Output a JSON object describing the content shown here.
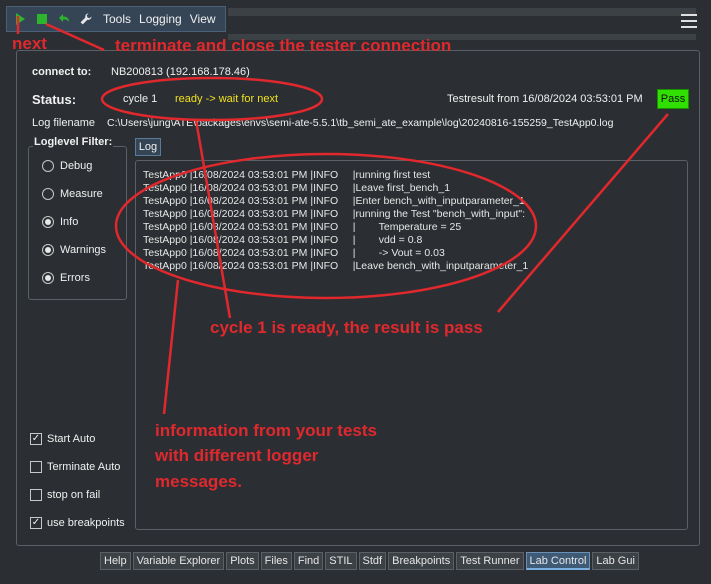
{
  "toolbar": {
    "menu_tools": "Tools",
    "menu_logging": "Logging",
    "menu_view": "View"
  },
  "connection": {
    "label": "connect to:",
    "value": "NB200813 (192.168.178.46)"
  },
  "status": {
    "label": "Status:",
    "cycle": "cycle 1",
    "state": "ready -> wait for next",
    "testresult": "Testresult from 16/08/2024 03:53:01 PM",
    "result_badge": "Pass"
  },
  "log_filename": {
    "label": "Log filename",
    "value": "C:\\Users\\jung\\ATE\\packages\\envs\\semi-ate-5.5.1\\tb_semi_ate_example\\log\\20240816-155259_TestApp0.log"
  },
  "loglevel_filter": {
    "title": "Loglevel Filter:",
    "options": [
      {
        "label": "Debug",
        "checked": false
      },
      {
        "label": "Measure",
        "checked": false
      },
      {
        "label": "Info",
        "checked": true
      },
      {
        "label": "Warnings",
        "checked": true
      },
      {
        "label": "Errors",
        "checked": true
      }
    ]
  },
  "options": {
    "start_auto": "Start Auto",
    "terminate_auto": "Terminate Auto",
    "stop_on_fail": "stop on fail",
    "use_breakpoints": "use breakpoints"
  },
  "log_tab": "Log",
  "log_lines": [
    "TestApp0 |16/08/2024 03:53:01 PM |INFO     |running first test",
    "TestApp0 |16/08/2024 03:53:01 PM |INFO     |Leave first_bench_1",
    "TestApp0 |16/08/2024 03:53:01 PM |INFO     |Enter bench_with_inputparameter_1",
    "TestApp0 |16/08/2024 03:53:01 PM |INFO     |running the Test \"bench_with_input\":",
    "TestApp0 |16/08/2024 03:53:01 PM |INFO     |        Temperature = 25",
    "TestApp0 |16/08/2024 03:53:01 PM |INFO     |        vdd = 0.8",
    "TestApp0 |16/08/2024 03:53:01 PM |INFO     |        -> Vout = 0.03",
    "TestApp0 |16/08/2024 03:53:01 PM |INFO     |Leave bench_with_inputparameter_1"
  ],
  "bottom_tabs": [
    "Help",
    "Variable Explorer",
    "Plots",
    "Files",
    "Find",
    "STIL",
    "Stdf",
    "Breakpoints",
    "Test Runner",
    "Lab Control",
    "Lab Gui"
  ],
  "active_bottom_tab": "Lab Control",
  "annotations": {
    "next": "next",
    "terminate": "terminate and close the tester connection",
    "cycle_ready": "cycle 1 is ready, the result is pass",
    "info_line1": "information from your tests",
    "info_line2": "with different logger",
    "info_line3": "messages."
  },
  "colors": {
    "annotation_red": "#e0282d",
    "pass_green": "#2fe000",
    "status_yellow": "#f0e020"
  },
  "icons": [
    "play-icon",
    "stop-icon",
    "undo-arrow-icon",
    "wrench-icon",
    "hamburger-menu-icon"
  ]
}
